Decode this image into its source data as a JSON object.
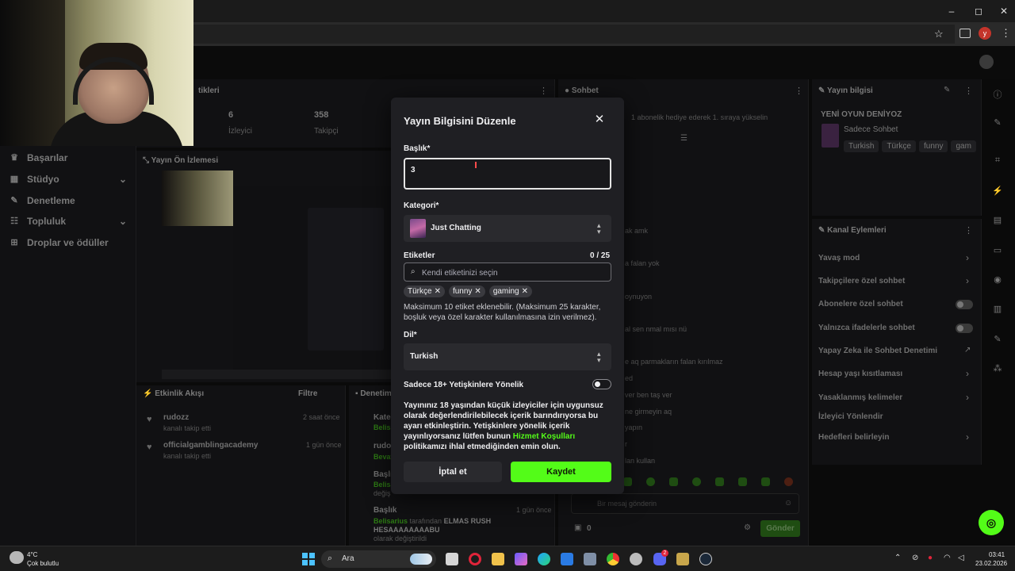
{
  "window": {
    "minimize": "–",
    "maximize": "◻",
    "close": "✕"
  },
  "browser": {
    "star_icon": "☆",
    "profile_initial": "y",
    "menu_icon": "⋮"
  },
  "sidebar": {
    "items": [
      {
        "label": "Başarılar",
        "icon": "trophy-icon",
        "glyph": "♛"
      },
      {
        "label": "Stüdyo",
        "icon": "studio-icon",
        "glyph": "▦",
        "chevron": "⌄"
      },
      {
        "label": "Denetleme",
        "icon": "wrench-icon",
        "glyph": "✎"
      },
      {
        "label": "Topluluk",
        "icon": "community-icon",
        "glyph": "☷",
        "chevron": "⌄"
      },
      {
        "label": "Droplar ve ödüller",
        "icon": "gift-icon",
        "glyph": "⊞"
      }
    ]
  },
  "stats": {
    "section_title_fragment": "tikleri",
    "viewers_value": "6",
    "viewers_label": "İzleyici",
    "followers_value": "358",
    "followers_label": "Takipçi"
  },
  "preview": {
    "title": "Yayın Ön İzlemesi"
  },
  "activity": {
    "title": "Etkinlik Akışı",
    "filter": "Filtre",
    "items": [
      {
        "name": "rudozz",
        "detail": "kanalı takip etti",
        "time": "2 saat önce"
      },
      {
        "name": "officialgamblingacademy",
        "detail": "kanalı takip etti",
        "time": "1 gün önce"
      }
    ]
  },
  "moderation": {
    "title_fragment": "Denetim",
    "rows": [
      {
        "label": "Kate",
        "sub": "Belis"
      },
      {
        "label": "rudo",
        "sub": "Bevat"
      },
      {
        "label": "Başlı",
        "sub": "Belisa",
        "sub2": "değiş"
      },
      {
        "label": "Başlık",
        "time": "1 gün önce",
        "user": "Belisarius",
        "middle": " tarafından ",
        "value": "ELMAS RUSH HESAAAAAAAABU",
        "tail": "olarak değiştirildi"
      }
    ]
  },
  "chat": {
    "title": "Sohbet",
    "pinned": "1 abonelik hediye ederek 1. sıraya yükselin",
    "fragments": [
      "ak amk",
      "a falan yok",
      "oynuyon",
      "al sen nmal mısı nü",
      "e aq parmakların falan kırılmaz",
      "ed",
      "ver ben taş ver",
      "ne girmeyin aq",
      "yapın",
      "r",
      "lan kullan"
    ],
    "input_placeholder": "Bir mesaj gönderin",
    "count": "0",
    "send": "Gönder"
  },
  "stream_info": {
    "title": "Yayın bilgisi",
    "stream_title": "YENİ OYUN DENİYOZ",
    "mode": "Sadece Sohbet",
    "tags": [
      "Turkish",
      "Türkçe",
      "funny",
      "gam"
    ]
  },
  "channel_actions": {
    "title": "Kanal Eylemleri",
    "items": [
      {
        "label": "Yavaş mod",
        "control": "chevron"
      },
      {
        "label": "Takipçilere özel sohbet",
        "control": "chevron"
      },
      {
        "label": "Abonelere özel sohbet",
        "control": "toggle"
      },
      {
        "label": "Yalnızca ifadelerle sohbet",
        "control": "toggle"
      },
      {
        "label": "Yapay Zeka ile Sohbet Denetimi",
        "control": "external"
      },
      {
        "label": "Hesap yaşı kısıtlaması",
        "control": "chevron"
      },
      {
        "label": "Yasaklanmış kelimeler",
        "control": "chevron"
      },
      {
        "label": "İzleyici Yönlendir",
        "control": "none"
      },
      {
        "label": "Hedefleri belirleyin",
        "control": "chevron"
      }
    ]
  },
  "modal": {
    "title": "Yayın Bilgisini Düzenle",
    "close": "✕",
    "title_label": "Başlık*",
    "title_value": "3",
    "category_label": "Kategori*",
    "category_value": "Just Chatting",
    "tags_label": "Etiketler",
    "tags_counter": "0 / 25",
    "tags_placeholder": "Kendi etiketinizi seçin",
    "selected_tags": [
      "Türkçe",
      "funny",
      "gaming"
    ],
    "tags_help": "Maksimum 10 etiket eklenebilir. (Maksimum 25 karakter, boşluk veya özel karakter kullanılmasına izin verilmez).",
    "language_label": "Dil*",
    "language_value": "Turkish",
    "adult_label": "Sadece 18+ Yetişkinlere Yönelik",
    "adult_enabled": false,
    "adult_text_before": "Yayınınız 18 yaşından küçük izleyiciler için uygunsuz olarak değerlendirilebilecek içerik barındırıyorsa bu ayarı etkinleştirin. Yetişkinlere yönelik içerik yayınlıyorsanız lütfen bunun ",
    "adult_link": "Hizmet Koşulları",
    "adult_text_after": " politikamızı ihlal etmediğinden emin olun.",
    "cancel": "İptal et",
    "save": "Kaydet"
  },
  "taskbar": {
    "weather_temp": "4°C",
    "weather_desc": "Çok bulutlu",
    "search_placeholder": "Ara",
    "time": "03:41",
    "date": "23.02.2026",
    "badge_count": "2"
  },
  "colors": {
    "accent": "#53fc18",
    "modal_bg": "#1f1f23",
    "page_bg": "#0a0a0a"
  }
}
